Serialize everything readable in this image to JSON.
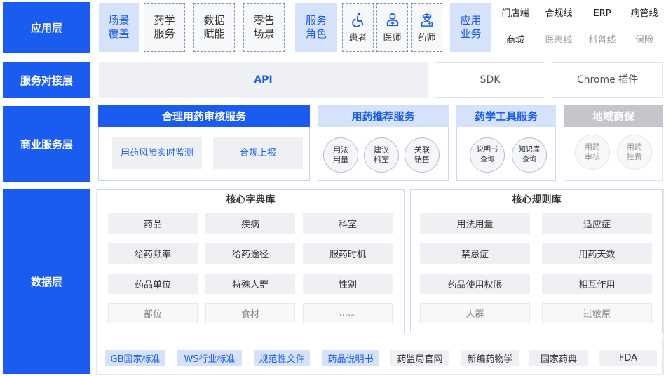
{
  "layers": {
    "app": "应用层",
    "service": "服务对接层",
    "business": "商业服务层",
    "data": "数据层"
  },
  "app": {
    "scene_cat": [
      "场景",
      "覆盖"
    ],
    "scenes": [
      {
        "l1": "药学",
        "l2": "服务"
      },
      {
        "l1": "数据",
        "l2": "赋能"
      },
      {
        "l1": "零售",
        "l2": "场景"
      }
    ],
    "role_cat": [
      "服务",
      "角色"
    ],
    "roles": [
      {
        "label": "患者",
        "icon": "accessibility-icon"
      },
      {
        "label": "医师",
        "icon": "doctor-icon"
      },
      {
        "label": "药师",
        "icon": "pharmacist-icon"
      }
    ],
    "biz_cat": [
      "应用",
      "业务"
    ],
    "biz_top": [
      "门店端",
      "合规线",
      "ERP",
      "病管线"
    ],
    "biz_bottom": [
      "商城",
      "医患线",
      "科普线",
      "保险"
    ]
  },
  "service": {
    "api": "API",
    "sdk": "SDK",
    "chrome": "Chrome 插件"
  },
  "business": {
    "audit": {
      "title": "合理用药审核服务",
      "items": [
        "用药风险实时监测",
        "合规上报"
      ]
    },
    "recommend": {
      "title": "用药推荐服务",
      "items": [
        [
          "用法",
          "用量"
        ],
        [
          "建议",
          "科室"
        ],
        [
          "关联",
          "销售"
        ]
      ]
    },
    "tools": {
      "title": "药学工具服务",
      "items": [
        [
          "说明书",
          "查询"
        ],
        [
          "知识库",
          "查询"
        ]
      ]
    },
    "region": {
      "title": "地域商保",
      "items": [
        [
          "用药",
          "审核"
        ],
        [
          "用药",
          "控费"
        ]
      ]
    }
  },
  "data": {
    "dict": {
      "title": "核心字典库",
      "rows": [
        [
          "药品",
          "疾病",
          "科室"
        ],
        [
          "给药频率",
          "给药途径",
          "服药时机"
        ],
        [
          "药品单位",
          "特殊人群",
          "性别"
        ],
        [
          "部位",
          "食材",
          "......"
        ]
      ]
    },
    "rules": {
      "title": "核心规则库",
      "rows": [
        [
          "用法用量",
          "适应症"
        ],
        [
          "禁忌症",
          "用药天数"
        ],
        [
          "药品使用权限",
          "相互作用"
        ],
        [
          "人群",
          "过敏原"
        ]
      ]
    },
    "standards": [
      "GB国家标准",
      "WS行业标准",
      "规范性文件",
      "药品说明书",
      "药监局官网",
      "新编药物学",
      "国家药典",
      "FDA"
    ]
  },
  "colors": {
    "primary": "#1a5cf0",
    "light_blue": "#d6e2fa",
    "grey": "#eef0f4",
    "region_head": "#c4c6cb"
  }
}
